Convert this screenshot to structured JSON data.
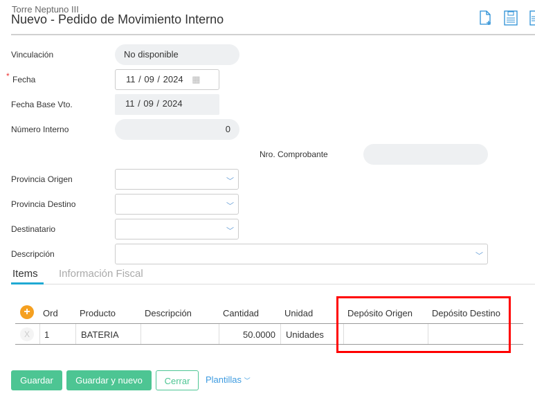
{
  "header": {
    "subtitle": "Torre Neptuno III",
    "title": "Nuevo - Pedido de Movimiento Interno"
  },
  "toolbar": {
    "icons": [
      "new-document-icon",
      "save-icon",
      "print-icon"
    ]
  },
  "form": {
    "vinculacion": {
      "label": "Vinculación",
      "value": "No disponible"
    },
    "fecha": {
      "label": "Fecha",
      "required": "*",
      "day": "11",
      "month": "09",
      "year": "2024"
    },
    "fecha_base": {
      "label": "Fecha Base Vto.",
      "day": "11",
      "month": "09",
      "year": "2024"
    },
    "numero_interno": {
      "label": "Número Interno",
      "value": "0"
    },
    "nro_comprobante": {
      "label": "Nro. Comprobante",
      "value": ""
    },
    "provincia_origen": {
      "label": "Provincia Origen"
    },
    "provincia_destino": {
      "label": "Provincia Destino"
    },
    "destinatario": {
      "label": "Destinatario"
    },
    "descripcion": {
      "label": "Descripción"
    }
  },
  "tabs": [
    {
      "label": "Items",
      "active": true
    },
    {
      "label": "Información Fiscal",
      "active": false
    }
  ],
  "table": {
    "columns": [
      "Ord",
      "Producto",
      "Descripción",
      "Cantidad",
      "Unidad",
      "Depósito Origen",
      "Depósito Destino"
    ],
    "rows": [
      {
        "delete": "X",
        "ord": "1",
        "producto": "BATERIA",
        "descripcion": "",
        "cantidad": "50.0000",
        "unidad": "Unidades",
        "deposito_origen": "",
        "deposito_destino": ""
      }
    ]
  },
  "actions": {
    "save": "Guardar",
    "save_new": "Guardar y nuevo",
    "close": "Cerrar",
    "templates": "Plantillas"
  },
  "colors": {
    "accent": "#4dc593",
    "tab": "#1fa9d3",
    "highlight": "#ff0000"
  }
}
